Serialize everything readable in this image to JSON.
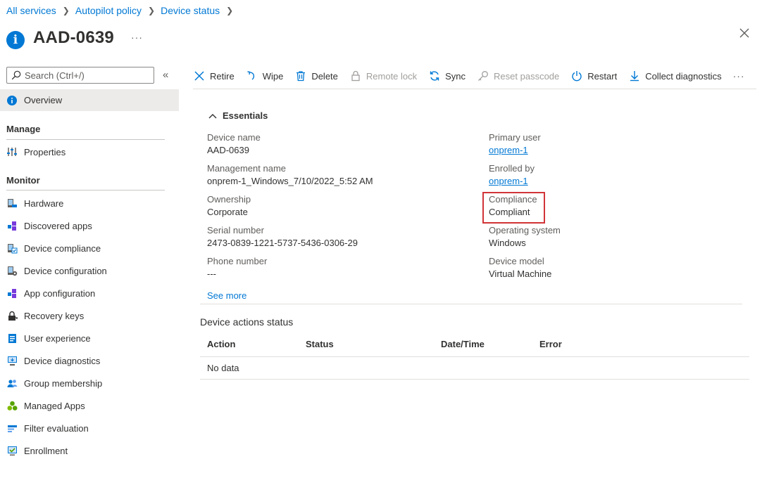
{
  "breadcrumb": [
    "All services",
    "Autopilot policy",
    "Device status"
  ],
  "page": {
    "title": "AAD-0639",
    "more": "···"
  },
  "search": {
    "placeholder": "Search (Ctrl+/)"
  },
  "nav": {
    "overview": "Overview",
    "manage_header": "Manage",
    "manage_items": [
      {
        "label": "Properties",
        "icon": "properties-icon"
      }
    ],
    "monitor_header": "Monitor",
    "monitor_items": [
      {
        "label": "Hardware",
        "icon": "hardware-icon"
      },
      {
        "label": "Discovered apps",
        "icon": "apps-icon"
      },
      {
        "label": "Device compliance",
        "icon": "compliance-icon"
      },
      {
        "label": "Device configuration",
        "icon": "configuration-icon"
      },
      {
        "label": "App configuration",
        "icon": "app-config-icon"
      },
      {
        "label": "Recovery keys",
        "icon": "lock-icon"
      },
      {
        "label": "User experience",
        "icon": "user-experience-icon"
      },
      {
        "label": "Device diagnostics",
        "icon": "diagnostics-icon"
      },
      {
        "label": "Group membership",
        "icon": "group-icon"
      },
      {
        "label": "Managed Apps",
        "icon": "managed-apps-icon"
      },
      {
        "label": "Filter evaluation",
        "icon": "filter-icon"
      },
      {
        "label": "Enrollment",
        "icon": "enrollment-icon"
      }
    ]
  },
  "toolbar": {
    "retire": "Retire",
    "wipe": "Wipe",
    "delete": "Delete",
    "remote_lock": "Remote lock",
    "sync": "Sync",
    "reset_passcode": "Reset passcode",
    "restart": "Restart",
    "collect_diagnostics": "Collect diagnostics",
    "more": "···"
  },
  "essentials": {
    "title": "Essentials",
    "left": [
      {
        "label": "Device name",
        "value": "AAD-0639"
      },
      {
        "label": "Management name",
        "value": "onprem-1_Windows_7/10/2022_5:52 AM"
      },
      {
        "label": "Ownership",
        "value": "Corporate"
      },
      {
        "label": "Serial number",
        "value": "2473-0839-1221-5737-5436-0306-29"
      },
      {
        "label": "Phone number",
        "value": "---"
      }
    ],
    "right": [
      {
        "label": "Primary user",
        "value": "onprem-1"
      },
      {
        "label": "Enrolled by",
        "value": "onprem-1"
      },
      {
        "label": "Compliance",
        "value": "Compliant"
      },
      {
        "label": "Operating system",
        "value": "Windows"
      },
      {
        "label": "Device model",
        "value": "Virtual Machine"
      }
    ],
    "see_more": "See more"
  },
  "actions": {
    "title": "Device actions status",
    "columns": [
      "Action",
      "Status",
      "Date/Time",
      "Error"
    ],
    "empty": "No data"
  },
  "colors": {
    "accent": "#0078d4",
    "highlight": "#d13438",
    "selected_bg": "#edebe9"
  }
}
